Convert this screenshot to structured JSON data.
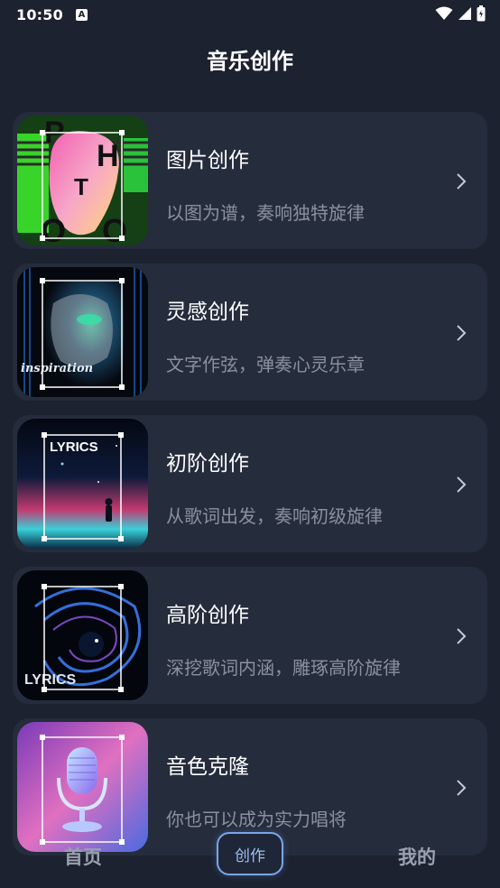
{
  "status": {
    "time": "10:50",
    "notif_glyph": "A"
  },
  "header": {
    "title": "音乐创作"
  },
  "cards": [
    {
      "title": "图片创作",
      "subtitle": "以图为谱，奏响独特旋律",
      "thumb_letters": [
        "P",
        "H",
        "T",
        "O",
        "O"
      ]
    },
    {
      "title": "灵感创作",
      "subtitle": "文字作弦，弹奏心灵乐章",
      "thumb_text": "inspiration"
    },
    {
      "title": "初阶创作",
      "subtitle": "从歌词出发，奏响初级旋律",
      "thumb_text": "LYRICS"
    },
    {
      "title": "高阶创作",
      "subtitle": "深挖歌词内涵，雕琢高阶旋律",
      "thumb_text": "LYRICS"
    },
    {
      "title": "音色克隆",
      "subtitle": "你也可以成为实力唱将"
    }
  ],
  "nav": {
    "home": "首页",
    "create": "创作",
    "mine": "我的"
  },
  "icons": {
    "wifi": "wifi-icon",
    "signal": "signal-icon",
    "battery": "battery-icon",
    "chevron": "chevron-right-icon",
    "mic": "microphone-icon"
  },
  "colors": {
    "background": "#1c2230",
    "card": "#252c3c",
    "subtitle": "#8a90a0",
    "accent": "#7aa6e8"
  }
}
